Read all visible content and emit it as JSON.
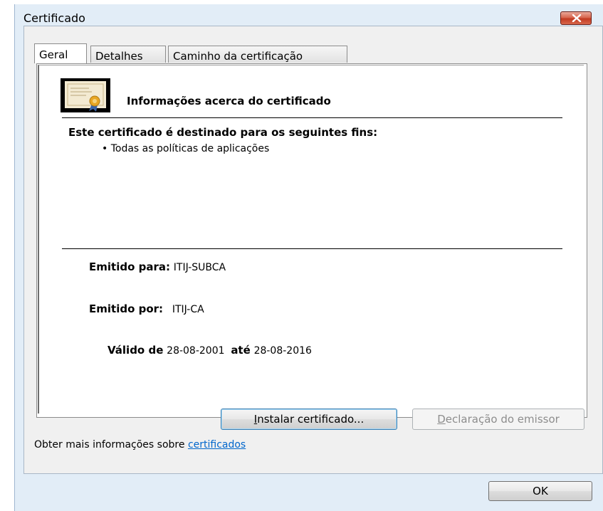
{
  "window": {
    "title": "Certificado"
  },
  "tabs": [
    {
      "label": "Geral",
      "active": true
    },
    {
      "label": "Detalhes",
      "active": false
    },
    {
      "label": "Caminho da certificação",
      "active": false
    }
  ],
  "general": {
    "heading": "Informações acerca do certificado",
    "purpose_title": "Este certificado é destinado para os seguintes fins:",
    "purposes": [
      "Todas as políticas de aplicações"
    ],
    "issued_to_label": "Emitido para:",
    "issued_to_value": "ITIJ-SUBCA",
    "issued_by_label": "Emitido por:",
    "issued_by_value": "ITIJ-CA",
    "valid_from_label": "Válido de",
    "valid_from_value": "28-08-2001",
    "valid_to_label": "até",
    "valid_to_value": "28-08-2016"
  },
  "buttons": {
    "install_hotkey": "I",
    "install_rest": "nstalar certificado...",
    "issuer_hotkey": "D",
    "issuer_rest": "eclaração do emissor",
    "ok": "OK"
  },
  "more_info": {
    "text": "Obter mais informações sobre",
    "link": "certificados"
  },
  "colors": {
    "link": "#0066cc",
    "close_button": "#c23b22",
    "frame": "#e2edf7"
  },
  "icons": [
    "certificate-icon",
    "close-icon"
  ]
}
